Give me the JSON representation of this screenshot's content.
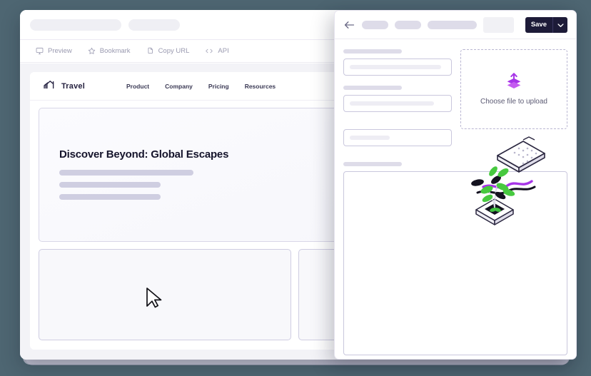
{
  "window": {
    "chrome": {
      "placeholder_pill_wide": "",
      "placeholder_pill_med": ""
    },
    "toolbar": {
      "items": [
        {
          "label": "Preview",
          "icon": "monitor-icon"
        },
        {
          "label": "Bookmark",
          "icon": "star-icon"
        },
        {
          "label": "Copy URL",
          "icon": "copy-icon"
        },
        {
          "label": "API",
          "icon": "code-brackets-icon"
        }
      ]
    }
  },
  "site": {
    "brand": {
      "name": "Travel",
      "logo_icon": "home-motion-icon"
    },
    "nav_links": [
      {
        "label": "Product"
      },
      {
        "label": "Company"
      },
      {
        "label": "Pricing"
      },
      {
        "label": "Resources"
      }
    ],
    "hero": {
      "title": "Discover Beyond: Global Escapes",
      "illustration": "isometric-plant-keyboard-illustration"
    },
    "cards": [
      {
        "name": "content-card-1"
      },
      {
        "name": "content-card-2"
      }
    ],
    "cursor_icon": "mouse-pointer-icon"
  },
  "panel": {
    "header": {
      "back_icon": "arrow-left-icon",
      "breadcrumb_pills": [
        "",
        "",
        ""
      ],
      "save_label": "Save",
      "caret_icon": "chevron-down-icon"
    },
    "form": {
      "fields": [
        {
          "label": "",
          "value": ""
        },
        {
          "label": "",
          "value": ""
        },
        {
          "label": "",
          "value": ""
        }
      ],
      "dropzone": {
        "label": "Choose file to upload",
        "icon": "upload-stack-icon"
      },
      "textarea": {
        "label": "",
        "value": ""
      }
    }
  },
  "colors": {
    "page_background": "#4e6672",
    "accent_upload": "#a734e8",
    "save_button": "#1d1b38",
    "placeholder_bar": "#cfcee1",
    "border": "#c9c7dd"
  }
}
